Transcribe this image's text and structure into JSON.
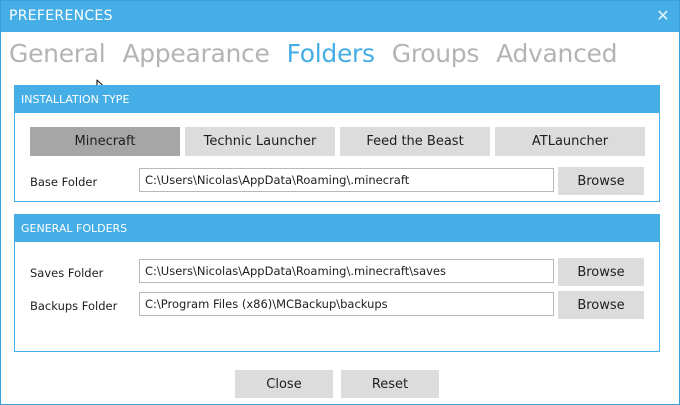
{
  "window": {
    "title": "PREFERENCES"
  },
  "tabs": [
    {
      "label": "General",
      "active": false
    },
    {
      "label": "Appearance",
      "active": false
    },
    {
      "label": "Folders",
      "active": true
    },
    {
      "label": "Groups",
      "active": false
    },
    {
      "label": "Advanced",
      "active": false
    }
  ],
  "installation_type": {
    "header": "INSTALLATION TYPE",
    "options": [
      "Minecraft",
      "Technic Launcher",
      "Feed the Beast",
      "ATLauncher"
    ],
    "selected": "Minecraft",
    "base_folder": {
      "label": "Base Folder",
      "value": "C:\\Users\\Nicolas\\AppData\\Roaming\\.minecraft",
      "browse_label": "Browse"
    }
  },
  "general_folders": {
    "header": "GENERAL FOLDERS",
    "saves": {
      "label": "Saves Folder",
      "value": "C:\\Users\\Nicolas\\AppData\\Roaming\\.minecraft\\saves",
      "browse_label": "Browse"
    },
    "backups": {
      "label": "Backups Folder",
      "value": "C:\\Program Files (x86)\\MCBackup\\backups",
      "browse_label": "Browse"
    }
  },
  "footer": {
    "close_label": "Close",
    "reset_label": "Reset"
  },
  "colors": {
    "accent": "#45aee6",
    "selected_button": "#a6a6a6",
    "button": "#dcdcdc",
    "inactive_tab": "#b4b4b4"
  },
  "icons": {
    "close": "close-icon",
    "cursor": "mouse-pointer-icon"
  }
}
